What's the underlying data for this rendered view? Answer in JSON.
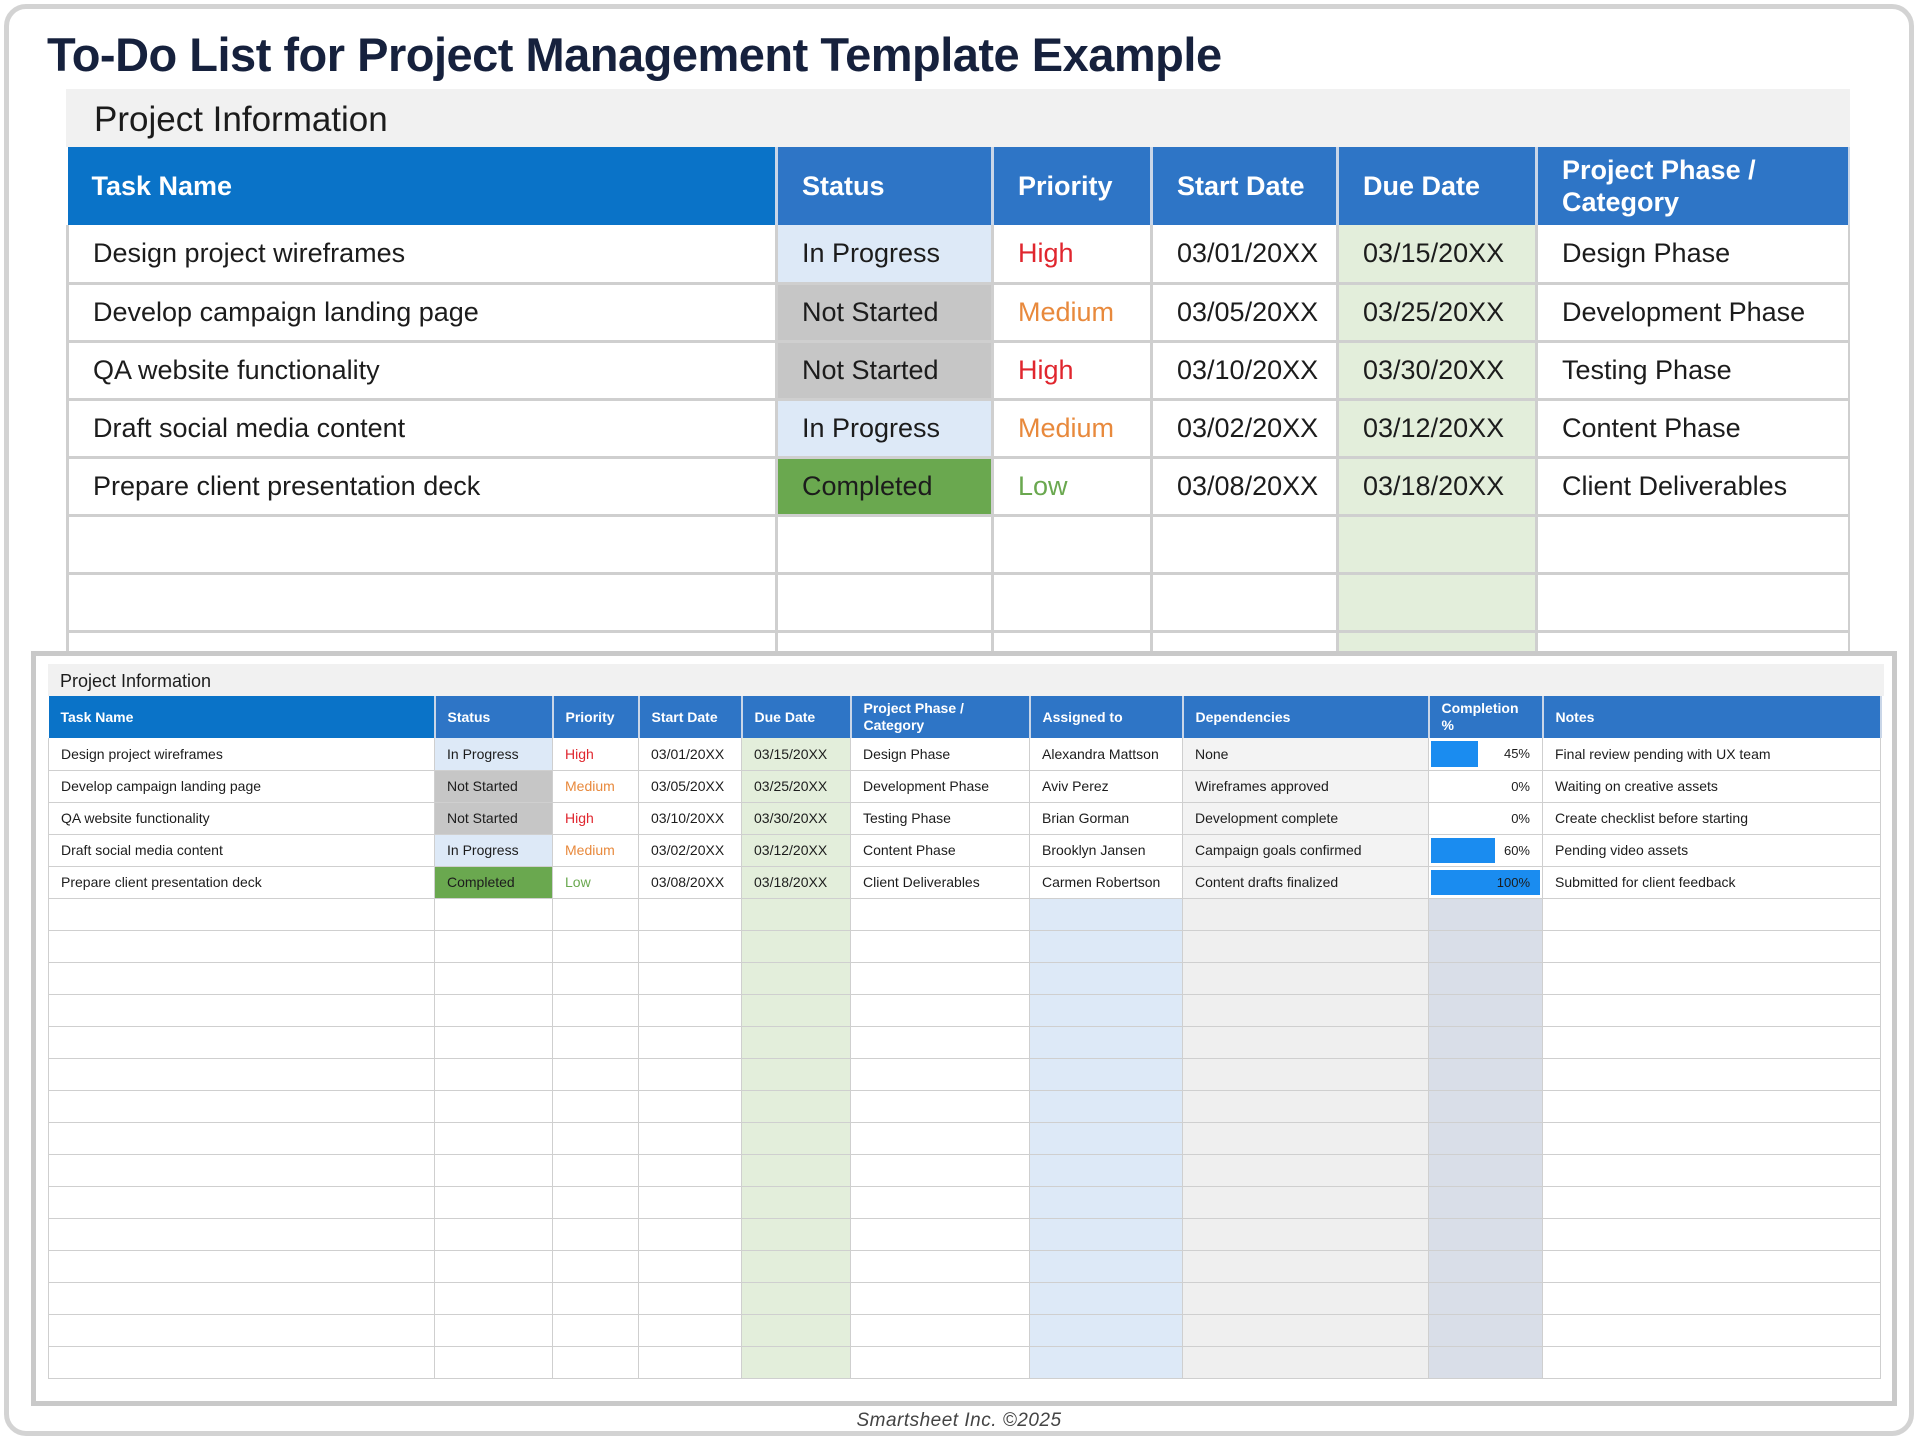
{
  "title": "To-Do List for Project Management Template Example",
  "section_label": "Project Information",
  "columns": {
    "task": "Task Name",
    "status": "Status",
    "priority": "Priority",
    "start": "Start Date",
    "due": "Due Date",
    "phase": "Project Phase / Category",
    "assigned": "Assigned to",
    "dependencies": "Dependencies",
    "completion": "Completion %",
    "notes": "Notes"
  },
  "tasks": [
    {
      "task": "Design project wireframes",
      "status": "In Progress",
      "priority": "High",
      "start": "03/01/20XX",
      "due": "03/15/20XX",
      "phase": "Design Phase",
      "assigned": "Alexandra Mattson",
      "dependencies": "None",
      "completion": "45%",
      "completion_value": 0.45,
      "notes": "Final review pending with UX team"
    },
    {
      "task": "Develop campaign landing page",
      "status": "Not Started",
      "priority": "Medium",
      "start": "03/05/20XX",
      "due": "03/25/20XX",
      "phase": "Development Phase",
      "assigned": "Aviv Perez",
      "dependencies": "Wireframes approved",
      "completion": "0%",
      "completion_value": 0,
      "notes": "Waiting on creative assets"
    },
    {
      "task": "QA website functionality",
      "status": "Not Started",
      "priority": "High",
      "start": "03/10/20XX",
      "due": "03/30/20XX",
      "phase": "Testing Phase",
      "assigned": "Brian Gorman",
      "dependencies": "Development complete",
      "completion": "0%",
      "completion_value": 0,
      "notes": "Create checklist before starting"
    },
    {
      "task": "Draft social media content",
      "status": "In Progress",
      "priority": "Medium",
      "start": "03/02/20XX",
      "due": "03/12/20XX",
      "phase": "Content Phase",
      "assigned": "Brooklyn Jansen",
      "dependencies": "Campaign goals confirmed",
      "completion": "60%",
      "completion_value": 0.6,
      "notes": "Pending video assets"
    },
    {
      "task": "Prepare client presentation deck",
      "status": "Completed",
      "priority": "Low",
      "start": "03/08/20XX",
      "due": "03/18/20XX",
      "phase": "Client Deliverables",
      "assigned": "Carmen Robertson",
      "dependencies": "Content drafts finalized",
      "completion": "100%",
      "completion_value": 1,
      "notes": "Submitted for client feedback"
    }
  ],
  "footer": "Smartsheet Inc. ©2025"
}
